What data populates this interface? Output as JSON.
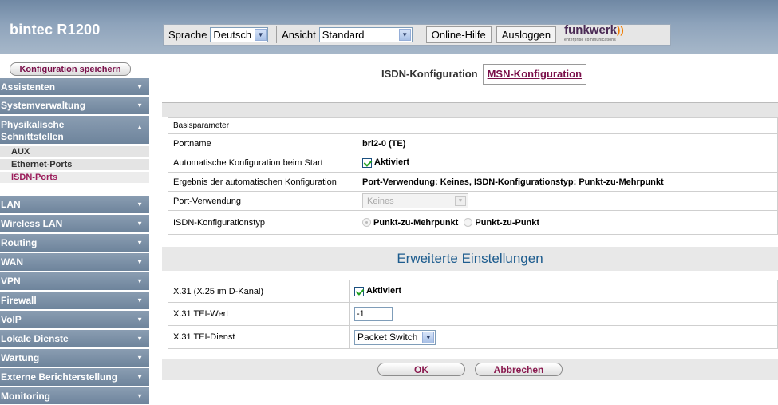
{
  "header": {
    "logo": "bintec R1200",
    "language_label": "Sprache",
    "language_value": "Deutsch",
    "view_label": "Ansicht",
    "view_value": "Standard",
    "help_label": "Online-Hilfe",
    "logout_label": "Ausloggen",
    "brand": "funkwerk",
    "brand_sub": "enterprise communications"
  },
  "sidebar": {
    "save_label": "Konfiguration speichern",
    "items": [
      {
        "label": "Assistenten"
      },
      {
        "label": "Systemverwaltung"
      },
      {
        "label": "Physikalische Schnittstellen",
        "line1": "Physikalische",
        "line2": "Schnittstellen",
        "expanded": true,
        "children": [
          {
            "label": "AUX"
          },
          {
            "label": "Ethernet-Ports"
          },
          {
            "label": "ISDN-Ports",
            "active": true
          }
        ]
      },
      {
        "label": "LAN"
      },
      {
        "label": "Wireless LAN"
      },
      {
        "label": "Routing"
      },
      {
        "label": "WAN"
      },
      {
        "label": "VPN"
      },
      {
        "label": "Firewall"
      },
      {
        "label": "VoIP"
      },
      {
        "label": "Lokale Dienste"
      },
      {
        "label": "Wartung"
      },
      {
        "label": "Externe Berichterstellung"
      },
      {
        "label": "Monitoring"
      }
    ]
  },
  "tabs": {
    "isdn": "ISDN-Konfiguration",
    "msn": "MSN-Konfiguration",
    "active": "ISDN-Konfiguration"
  },
  "basic": {
    "section": "Basisparameter",
    "portname_label": "Portname",
    "portname_value": "bri2-0  (TE)",
    "auto_label": "Automatische Konfiguration beim Start",
    "auto_value": "Aktiviert",
    "auto_checked": true,
    "result_label": "Ergebnis der automatischen Konfiguration",
    "result_value": "Port-Verwendung:  Keines,  ISDN-Konfigurationstyp:  Punkt-zu-Mehrpunkt",
    "usage_label": "Port-Verwendung",
    "usage_value": "Keines",
    "type_label": "ISDN-Konfigurationstyp",
    "type_opt1": "Punkt-zu-Mehrpunkt",
    "type_opt2": "Punkt-zu-Punkt",
    "type_selected": "Punkt-zu-Mehrpunkt"
  },
  "advanced": {
    "title": "Erweiterte Einstellungen",
    "x31_label": "X.31 (X.25 im D-Kanal)",
    "x31_value": "Aktiviert",
    "x31_checked": true,
    "tei_label": "X.31 TEI-Wert",
    "tei_value": "-1",
    "service_label": "X.31 TEI-Dienst",
    "service_value": "Packet Switch"
  },
  "footer": {
    "ok": "OK",
    "cancel": "Abbrechen"
  }
}
